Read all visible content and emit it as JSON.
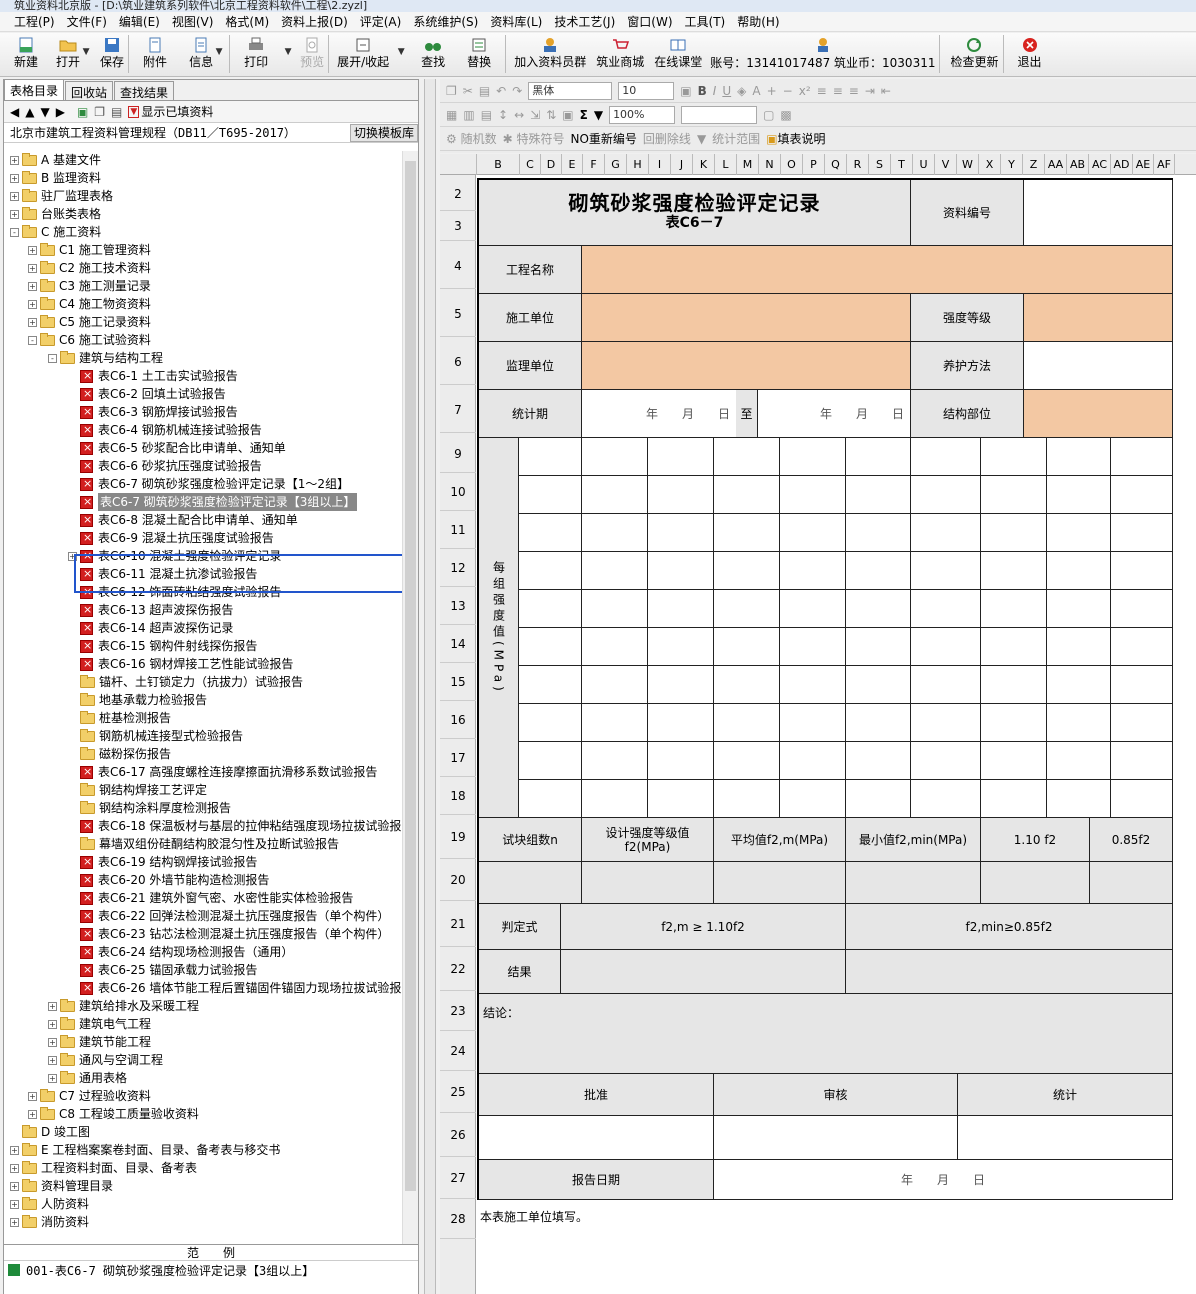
{
  "window": {
    "title": "筑业资料北京版 - [D:\\筑业建筑系列软件\\北京工程资料软件\\工程\\2.zyzl]"
  },
  "menu": [
    "工程(P)",
    "文件(F)",
    "编辑(E)",
    "视图(V)",
    "格式(M)",
    "资料上报(D)",
    "评定(A)",
    "系统维护(S)",
    "资料库(L)",
    "技术工艺(J)",
    "窗口(W)",
    "工具(T)",
    "帮助(H)"
  ],
  "toolbar": {
    "new": "新建",
    "open": "打开",
    "save": "保存",
    "attach": "附件",
    "info": "信息",
    "print": "打印",
    "preview": "预览",
    "expand": "展开/收起",
    "find": "查找",
    "replace": "替换",
    "join": "加入资料员群",
    "mall": "筑业商城",
    "class": "在线课堂",
    "account": "账号：13141017487 筑业币：1030311",
    "update": "检查更新",
    "exit": "退出"
  },
  "left": {
    "tabs": [
      "表格目录",
      "回收站",
      "查找结果"
    ],
    "show_filled": "显示已填资料",
    "path": "北京市建筑工程资料管理规程（DB11／T695-2017）",
    "switch_btn": "切换模板库",
    "tree": [
      {
        "lv": 0,
        "exp": "+",
        "icon": "folder",
        "text": "A 基建文件"
      },
      {
        "lv": 0,
        "exp": "+",
        "icon": "folder",
        "text": "B 监理资料"
      },
      {
        "lv": 0,
        "exp": "+",
        "icon": "folder",
        "text": "驻厂监理表格"
      },
      {
        "lv": 0,
        "exp": "+",
        "icon": "folder",
        "text": "台账类表格"
      },
      {
        "lv": 0,
        "exp": "-",
        "icon": "folder",
        "text": "C 施工资料"
      },
      {
        "lv": 1,
        "exp": "+",
        "icon": "folder",
        "text": "C1 施工管理资料"
      },
      {
        "lv": 1,
        "exp": "+",
        "icon": "folder",
        "text": "C2 施工技术资料"
      },
      {
        "lv": 1,
        "exp": "+",
        "icon": "folder",
        "text": "C3 施工测量记录"
      },
      {
        "lv": 1,
        "exp": "+",
        "icon": "folder",
        "text": "C4 施工物资资料"
      },
      {
        "lv": 1,
        "exp": "+",
        "icon": "folder",
        "text": "C5 施工记录资料"
      },
      {
        "lv": 1,
        "exp": "-",
        "icon": "folder",
        "text": "C6 施工试验资料"
      },
      {
        "lv": 2,
        "exp": "-",
        "icon": "folder",
        "text": "建筑与结构工程"
      },
      {
        "lv": 3,
        "exp": "",
        "icon": "xls",
        "text": "表C6-1 土工击实试验报告"
      },
      {
        "lv": 3,
        "exp": "",
        "icon": "xls",
        "text": "表C6-2 回填土试验报告"
      },
      {
        "lv": 3,
        "exp": "",
        "icon": "xls",
        "text": "表C6-3 钢筋焊接试验报告"
      },
      {
        "lv": 3,
        "exp": "",
        "icon": "xls",
        "text": "表C6-4 钢筋机械连接试验报告"
      },
      {
        "lv": 3,
        "exp": "",
        "icon": "xls",
        "text": "表C6-5 砂浆配合比申请单、通知单"
      },
      {
        "lv": 3,
        "exp": "",
        "icon": "xls",
        "text": "表C6-6 砂浆抗压强度试验报告"
      },
      {
        "lv": 3,
        "exp": "",
        "icon": "xls",
        "text": "表C6-7 砌筑砂浆强度检验评定记录【1～2组】"
      },
      {
        "lv": 3,
        "exp": "",
        "icon": "xls",
        "text": "表C6-7 砌筑砂浆强度检验评定记录【3组以上】",
        "sel": true
      },
      {
        "lv": 3,
        "exp": "",
        "icon": "xls",
        "text": "表C6-8 混凝土配合比申请单、通知单"
      },
      {
        "lv": 3,
        "exp": "",
        "icon": "xls",
        "text": "表C6-9 混凝土抗压强度试验报告"
      },
      {
        "lv": 3,
        "exp": "+",
        "icon": "xls",
        "text": "表C6-10 混凝土强度检验评定记录"
      },
      {
        "lv": 3,
        "exp": "",
        "icon": "xls",
        "text": "表C6-11 混凝土抗渗试验报告"
      },
      {
        "lv": 3,
        "exp": "",
        "icon": "xls",
        "text": "表C6-12 饰面砖粘结强度试验报告"
      },
      {
        "lv": 3,
        "exp": "",
        "icon": "xls",
        "text": "表C6-13 超声波探伤报告"
      },
      {
        "lv": 3,
        "exp": "",
        "icon": "xls",
        "text": "表C6-14 超声波探伤记录"
      },
      {
        "lv": 3,
        "exp": "",
        "icon": "xls",
        "text": "表C6-15 钢构件射线探伤报告"
      },
      {
        "lv": 3,
        "exp": "",
        "icon": "xls",
        "text": "表C6-16 钢材焊接工艺性能试验报告"
      },
      {
        "lv": 3,
        "exp": "",
        "icon": "folder",
        "text": "锚杆、土钉锁定力（抗拔力）试验报告"
      },
      {
        "lv": 3,
        "exp": "",
        "icon": "folder",
        "text": "地基承载力检验报告"
      },
      {
        "lv": 3,
        "exp": "",
        "icon": "folder",
        "text": "桩基检测报告"
      },
      {
        "lv": 3,
        "exp": "",
        "icon": "folder",
        "text": "钢筋机械连接型式检验报告"
      },
      {
        "lv": 3,
        "exp": "",
        "icon": "folder",
        "text": "磁粉探伤报告"
      },
      {
        "lv": 3,
        "exp": "",
        "icon": "xls",
        "text": "表C6-17 高强度螺栓连接摩擦面抗滑移系数试验报告"
      },
      {
        "lv": 3,
        "exp": "",
        "icon": "folder",
        "text": "钢结构焊接工艺评定"
      },
      {
        "lv": 3,
        "exp": "",
        "icon": "folder",
        "text": "钢结构涂料厚度检测报告"
      },
      {
        "lv": 3,
        "exp": "",
        "icon": "xls",
        "text": "表C6-18 保温板材与基层的拉伸粘结强度现场拉拔试验报"
      },
      {
        "lv": 3,
        "exp": "",
        "icon": "folder",
        "text": "幕墙双组份硅酮结构胶混匀性及拉断试验报告"
      },
      {
        "lv": 3,
        "exp": "",
        "icon": "xls",
        "text": "表C6-19 结构钢焊接试验报告"
      },
      {
        "lv": 3,
        "exp": "",
        "icon": "xls",
        "text": "表C6-20 外墙节能构造检测报告"
      },
      {
        "lv": 3,
        "exp": "",
        "icon": "xls",
        "text": "表C6-21 建筑外窗气密、水密性能实体检验报告"
      },
      {
        "lv": 3,
        "exp": "",
        "icon": "xls",
        "text": "表C6-22 回弹法检测混凝土抗压强度报告（单个构件）"
      },
      {
        "lv": 3,
        "exp": "",
        "icon": "xls",
        "text": "表C6-23 钻芯法检测混凝土抗压强度报告（单个构件）"
      },
      {
        "lv": 3,
        "exp": "",
        "icon": "xls",
        "text": "表C6-24 结构现场检测报告（通用）"
      },
      {
        "lv": 3,
        "exp": "",
        "icon": "xls",
        "text": "表C6-25 锚固承载力试验报告"
      },
      {
        "lv": 3,
        "exp": "",
        "icon": "xls",
        "text": "表C6-26 墙体节能工程后置锚固件锚固力现场拉拔试验报"
      },
      {
        "lv": 2,
        "exp": "+",
        "icon": "folder",
        "text": "建筑给排水及采暖工程"
      },
      {
        "lv": 2,
        "exp": "+",
        "icon": "folder",
        "text": "建筑电气工程"
      },
      {
        "lv": 2,
        "exp": "+",
        "icon": "folder",
        "text": "建筑节能工程"
      },
      {
        "lv": 2,
        "exp": "+",
        "icon": "folder",
        "text": "通风与空调工程"
      },
      {
        "lv": 2,
        "exp": "+",
        "icon": "folder",
        "text": "通用表格"
      },
      {
        "lv": 1,
        "exp": "+",
        "icon": "folder",
        "text": "C7 过程验收资料"
      },
      {
        "lv": 1,
        "exp": "+",
        "icon": "folder",
        "text": "C8 工程竣工质量验收资料"
      },
      {
        "lv": 0,
        "exp": "",
        "icon": "folder",
        "text": "D 竣工图"
      },
      {
        "lv": 0,
        "exp": "+",
        "icon": "folder",
        "text": "E 工程档案案卷封面、目录、备考表与移交书"
      },
      {
        "lv": 0,
        "exp": "+",
        "icon": "folder",
        "text": "工程资料封面、目录、备考表"
      },
      {
        "lv": 0,
        "exp": "+",
        "icon": "folder",
        "text": "资料管理目录"
      },
      {
        "lv": 0,
        "exp": "+",
        "icon": "folder",
        "text": "人防资料"
      },
      {
        "lv": 0,
        "exp": "+",
        "icon": "folder",
        "text": "消防资料"
      }
    ],
    "legend_header": "范　　例",
    "legend_item": "001-表C6-7 砌筑砂浆强度检验评定记录【3组以上】"
  },
  "right": {
    "font": "黑体",
    "size": "10",
    "zoom": "100%",
    "row3": [
      "随机数",
      "特殊符号",
      "NO重新编号",
      "回删除线",
      "统计范围",
      "填表说明"
    ],
    "cols": [
      "B",
      "C",
      "D",
      "E",
      "F",
      "G",
      "H",
      "I",
      "J",
      "K",
      "L",
      "M",
      "N",
      "O",
      "P",
      "Q",
      "R",
      "S",
      "T",
      "U",
      "V",
      "W",
      "X",
      "Y",
      "Z",
      "AA",
      "AB",
      "AC",
      "AD",
      "AE",
      "AF"
    ],
    "rows": [
      "2",
      "3",
      "4",
      "5",
      "6",
      "7",
      "9",
      "10",
      "11",
      "12",
      "13",
      "14",
      "15",
      "16",
      "17",
      "18",
      "19",
      "20",
      "21",
      "22",
      "23",
      "24",
      "25",
      "26",
      "27",
      "28"
    ]
  },
  "form": {
    "title": "砌筑砂浆强度检验评定记录",
    "subtitle": "表C6－7",
    "doc_no": "资料编号",
    "project": "工程名称",
    "builder": "施工单位",
    "grade": "强度等级",
    "supervisor": "监理单位",
    "curing": "养护方法",
    "period": "统计期",
    "date1": "年　　月　　日",
    "to": "至",
    "date2": "年　　月　　日",
    "part": "结构部位",
    "strength_label": "每组强度值(MPa)",
    "h_n": "试块组数n",
    "h_f2": "设计强度等级值f2(MPa)",
    "h_avg": "平均值f2,m(MPa)",
    "h_min": "最小值f2,min(MPa)",
    "h_110": "1.10 f2",
    "h_085": "0.85f2",
    "judge": "判定式",
    "formula1": "f2,m ≥ 1.10f2",
    "formula2": "f2,min≥0.85f2",
    "result": "结果",
    "conclusion": "结论：",
    "approve": "批准",
    "review": "审核",
    "stat": "统计",
    "report_date": "报告日期",
    "date3": "年　　月　　日",
    "note": "本表施工单位填写。"
  },
  "colors": {
    "peach": "#f3c8a3",
    "gray": "#e6e6e6",
    "selection": "#2255cc"
  }
}
